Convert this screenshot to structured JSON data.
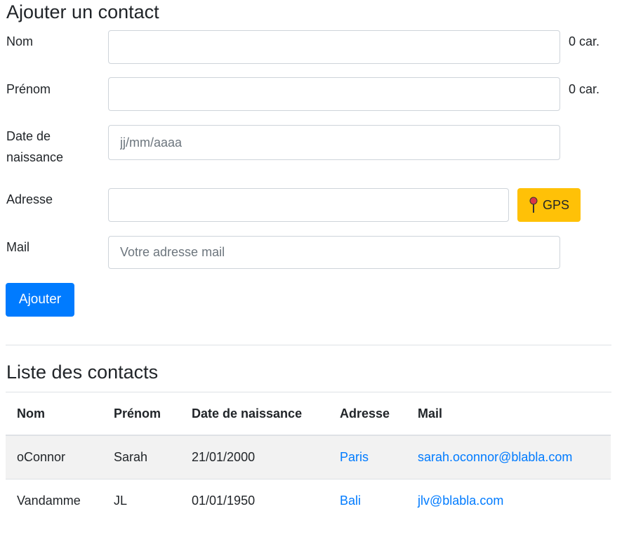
{
  "form": {
    "title": "Ajouter un contact",
    "nom": {
      "label": "Nom",
      "value": "",
      "counter": "0 car."
    },
    "prenom": {
      "label": "Prénom",
      "value": "",
      "counter": "0 car."
    },
    "date": {
      "label_line1": "Date de",
      "label_line2": "naissance",
      "placeholder": "jj/mm/aaaa"
    },
    "adresse": {
      "label": "Adresse",
      "value": "",
      "gps_label": "GPS",
      "gps_icon": "pushpin-icon"
    },
    "mail": {
      "label": "Mail",
      "placeholder": "Votre adresse mail"
    },
    "submit_label": "Ajouter"
  },
  "list": {
    "title": "Liste des contacts",
    "columns": [
      "Nom",
      "Prénom",
      "Date de naissance",
      "Adresse",
      "Mail"
    ],
    "rows": [
      [
        "oConnor",
        "Sarah",
        "21/01/2000",
        "Paris",
        "sarah.oconnor@blabla.com"
      ],
      [
        "Vandamme",
        "JL",
        "01/01/1950",
        "Bali",
        "jlv@blabla.com"
      ]
    ]
  },
  "colors": {
    "primary": "#007bff",
    "warning": "#ffc107",
    "stripe": "#f2f2f2"
  }
}
